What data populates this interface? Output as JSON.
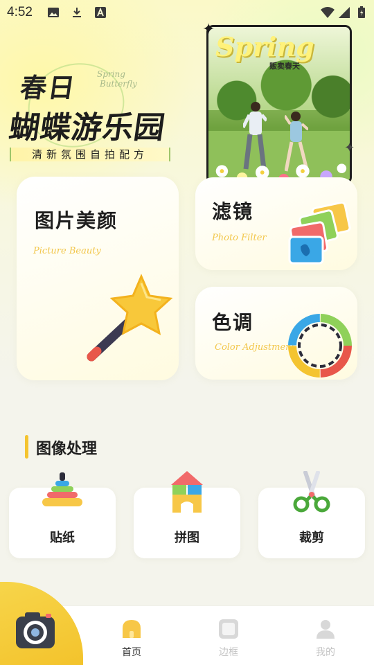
{
  "status_bar": {
    "time": "4:52"
  },
  "hero": {
    "title_line1": "春日",
    "script_text_line1": "Spring",
    "script_text_line2": "Butterfly",
    "title_line2": "蝴蝶游乐园",
    "subtitle": "清新氛围自拍配方",
    "photo_script": "Spring",
    "photo_caption": "贩卖春天"
  },
  "features": {
    "beauty": {
      "title": "图片美颜",
      "subtitle": "Picture Beauty"
    },
    "filter": {
      "title": "滤镜",
      "subtitle": "Photo Filter"
    },
    "color": {
      "title": "色调",
      "subtitle": "Color Adjustment"
    }
  },
  "section": {
    "title": "图像处理"
  },
  "tools": [
    {
      "label": "贴纸",
      "icon": "ring-stack-icon"
    },
    {
      "label": "拼图",
      "icon": "building-blocks-icon"
    },
    {
      "label": "裁剪",
      "icon": "scissors-icon"
    }
  ],
  "nav": {
    "home": "首页",
    "frame": "边框",
    "mine": "我的",
    "active_color": "#333333",
    "inactive_color": "#c4c4c4"
  },
  "colors": {
    "accent_yellow": "#f4c430",
    "subtitle_yellow": "#f2c64a"
  }
}
